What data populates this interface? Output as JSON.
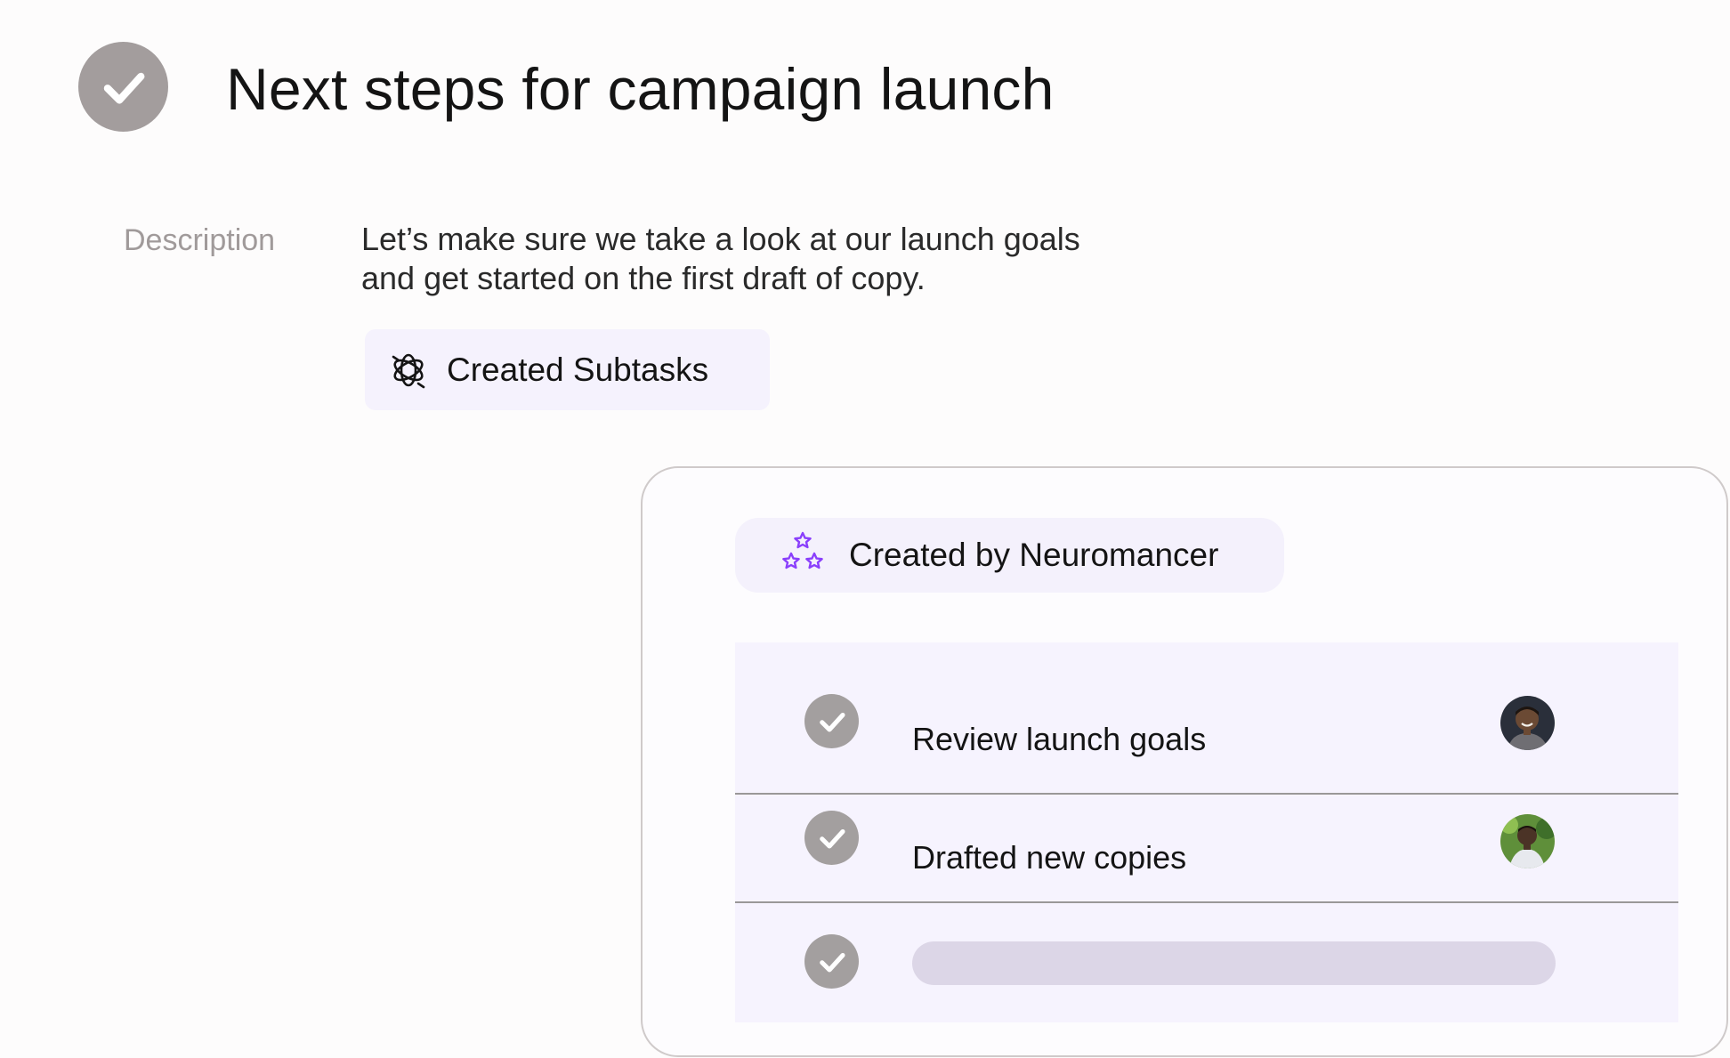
{
  "header": {
    "title": "Next steps for campaign launch",
    "check_icon": "check-circle-icon"
  },
  "description": {
    "label": "Description",
    "text": "Let’s make sure we take a look at our launch goals and get started on the first draft of copy."
  },
  "subtasks_chip": {
    "label": "Created Subtasks",
    "icon": "ai-sparkle-knot-icon"
  },
  "panel": {
    "badge": {
      "label": "Created by Neuromancer",
      "icon": "three-stars-icon",
      "icon_color": "#8a3ffc"
    },
    "subtasks": [
      {
        "title": "Review launch goals",
        "avatar": "avatar-man-dark-bg"
      },
      {
        "title": "Drafted new copies",
        "avatar": "avatar-man-green-bg"
      }
    ]
  },
  "colors": {
    "check_fill": "#a39d9d",
    "chip_bg": "#f5f2fd",
    "list_bg": "#f6f3fe",
    "placeholder": "#dcd6e7"
  }
}
